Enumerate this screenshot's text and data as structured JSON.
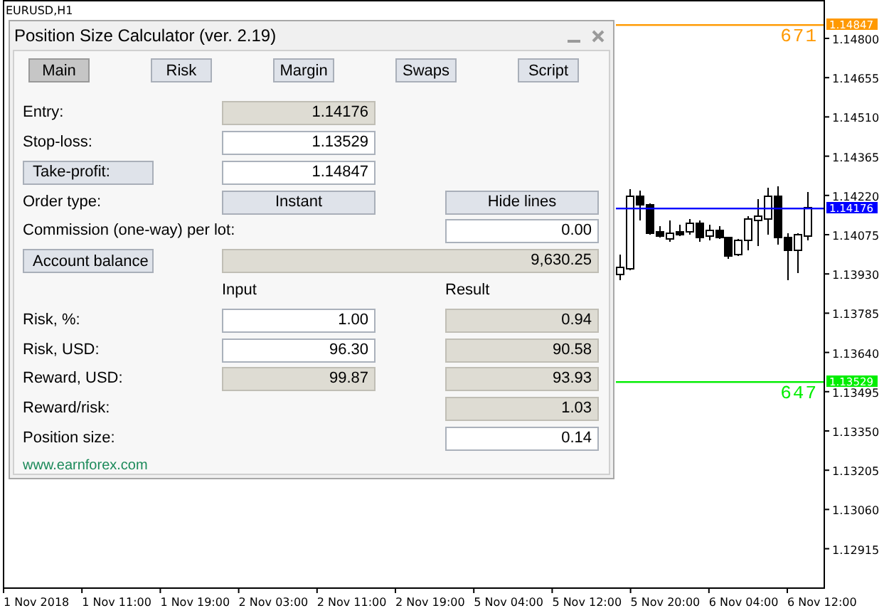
{
  "chart": {
    "symbol": "EURUSD,H1",
    "price_labels": [
      "1.14800",
      "1.14655",
      "1.14510",
      "1.14365",
      "1.14220",
      "1.14075",
      "1.13930",
      "1.13785",
      "1.13640",
      "1.13495",
      "1.13350",
      "1.13205",
      "1.13060",
      "1.12915"
    ],
    "time_labels": [
      "1 Nov 2018",
      "1 Nov 11:00",
      "1 Nov 19:00",
      "2 Nov 03:00",
      "2 Nov 11:00",
      "2 Nov 19:00",
      "5 Nov 04:00",
      "5 Nov 12:00",
      "5 Nov 20:00",
      "6 Nov 04:00",
      "6 Nov 12:00"
    ],
    "lines": [
      {
        "kind": "take_profit",
        "tag": "1.14847",
        "distance": "671",
        "color": "#ff9900"
      },
      {
        "kind": "entry",
        "tag": "1.14176",
        "color": "#0000ff"
      },
      {
        "kind": "stop_loss",
        "tag": "1.13529",
        "distance": "647",
        "color": "#00ee00"
      }
    ]
  },
  "panel": {
    "title": "Position Size Calculator (ver. 2.19)",
    "tabs": [
      {
        "label": "Main",
        "selected": true
      },
      {
        "label": "Risk",
        "selected": false
      },
      {
        "label": "Margin",
        "selected": false
      },
      {
        "label": "Swaps",
        "selected": false
      },
      {
        "label": "Script",
        "selected": false
      }
    ],
    "rows": [
      {
        "label": {
          "kind": "text",
          "text": "Entry:"
        },
        "input": {
          "kind": "field",
          "value": "1.14176",
          "editable": false
        }
      },
      {
        "label": {
          "kind": "text",
          "text": "Stop-loss:"
        },
        "input": {
          "kind": "field",
          "value": "1.13529",
          "editable": true
        }
      },
      {
        "label": {
          "kind": "button",
          "text": "Take-profit:"
        },
        "input": {
          "kind": "field",
          "value": "1.14847",
          "editable": true
        }
      },
      {
        "label": {
          "kind": "text",
          "text": "Order type:"
        },
        "input": {
          "kind": "button",
          "text": "Instant"
        },
        "result": {
          "kind": "button",
          "text": "Hide lines"
        }
      },
      {
        "label": {
          "kind": "text",
          "text": "Commission (one-way) per lot:"
        },
        "result": {
          "kind": "field",
          "value": "0.00",
          "editable": true
        }
      },
      {
        "label": {
          "kind": "button",
          "text": "Account balance"
        },
        "input": {
          "kind": "wide_field",
          "value": "9,630.25",
          "editable": false
        }
      },
      {
        "input": {
          "kind": "heading",
          "text": "Input"
        },
        "result": {
          "kind": "heading",
          "text": "Result"
        }
      },
      {
        "label": {
          "kind": "text",
          "text": "Risk, %:"
        },
        "input": {
          "kind": "field",
          "value": "1.00",
          "editable": true
        },
        "result": {
          "kind": "field",
          "value": "0.94",
          "editable": false
        }
      },
      {
        "label": {
          "kind": "text",
          "text": "Risk, USD:"
        },
        "input": {
          "kind": "field",
          "value": "96.30",
          "editable": true
        },
        "result": {
          "kind": "field",
          "value": "90.58",
          "editable": false
        }
      },
      {
        "label": {
          "kind": "text",
          "text": "Reward, USD:"
        },
        "input": {
          "kind": "field",
          "value": "99.87",
          "editable": false
        },
        "result": {
          "kind": "field",
          "value": "93.93",
          "editable": false
        }
      },
      {
        "label": {
          "kind": "text",
          "text": "Reward/risk:"
        },
        "result": {
          "kind": "field",
          "value": "1.03",
          "editable": false
        }
      },
      {
        "label": {
          "kind": "text",
          "text": "Position size:"
        },
        "result": {
          "kind": "field",
          "value": "0.14",
          "editable": true
        }
      }
    ],
    "link": "www.earnforex.com"
  }
}
